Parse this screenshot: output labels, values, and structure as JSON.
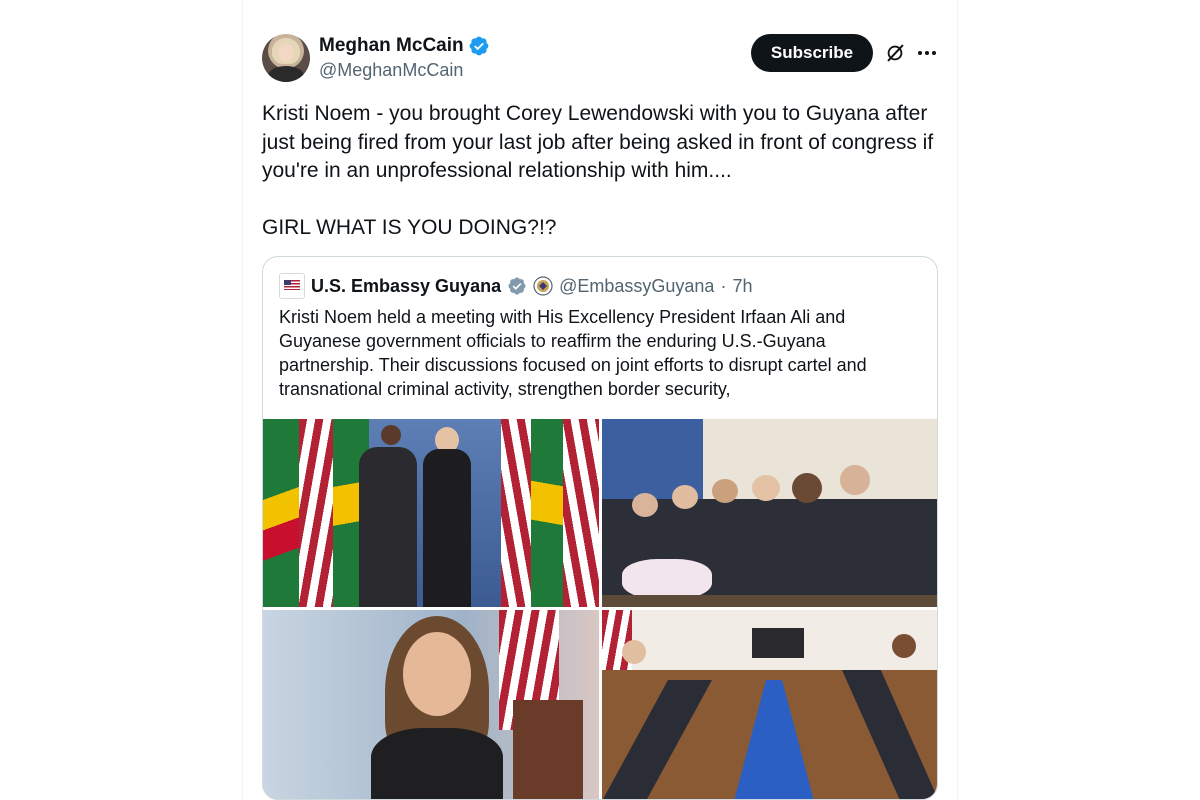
{
  "post": {
    "author": {
      "display_name": "Meghan McCain",
      "handle": "@MeghanMcCain",
      "verified_icon": "verified-badge-icon",
      "avatar_icon": "profile-avatar"
    },
    "subscribe_label": "Subscribe",
    "icons": {
      "grok": "grok-icon",
      "more": "more-options-icon"
    },
    "text": "Kristi Noem - you brought Corey Lewendowski with you to Guyana after just being fired from your last job after being asked in front of congress if you're in an unprofessional relationship with him....\n\nGIRL WHAT IS YOU DOING?!?"
  },
  "quoted_post": {
    "display_name": "U.S. Embassy Guyana",
    "handle": "@EmbassyGuyana",
    "separator": "·",
    "time": "7h",
    "text": "Kristi Noem held a meeting with His Excellency President Irfaan Ali and Guyanese government officials to reaffirm the enduring U.S.-Guyana partnership. Their discussions focused on joint efforts to disrupt cartel and transnational criminal activity, strengthen border security,",
    "photos": [
      "handshake-photo",
      "meeting-side-view-photo",
      "kristi-noem-portrait-photo",
      "conference-table-photo"
    ]
  },
  "colors": {
    "text_primary": "#0f1419",
    "text_secondary": "#536471",
    "border": "#cfd9de",
    "verified_blue": "#1d9bf0",
    "gov_gray": "#829aab",
    "button_bg": "#0f1419"
  }
}
